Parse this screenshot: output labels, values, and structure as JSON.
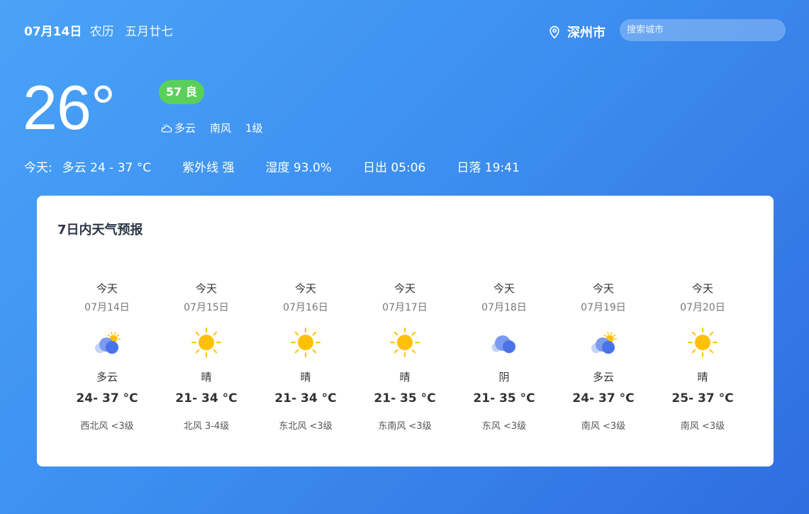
{
  "header": {
    "date": "07月14日",
    "lunar_label": "农历",
    "lunar_day": "五月廿七",
    "city": "深州市",
    "search_placeholder": "搜索城市"
  },
  "current": {
    "temperature": "26°",
    "aqi": "57 良",
    "condition": "多云",
    "wind_dir": "南风",
    "wind_level": "1级",
    "today_label": "今天:",
    "today_summary": "多云 24 - 37 °C",
    "uv": "紫外线 强",
    "humidity": "湿度 93.0%",
    "sunrise": "日出 05:06",
    "sunset": "日落 19:41"
  },
  "forecast": {
    "title": "7日内天气预报",
    "days": [
      {
        "label": "今天",
        "date": "07月14日",
        "icon": "partly-cloudy-icon",
        "desc": "多云",
        "range": "24- 37 °C",
        "wind": "西北风 <3级"
      },
      {
        "label": "今天",
        "date": "07月15日",
        "icon": "sunny-icon",
        "desc": "晴",
        "range": "21- 34 °C",
        "wind": "北风 3-4级"
      },
      {
        "label": "今天",
        "date": "07月16日",
        "icon": "sunny-icon",
        "desc": "晴",
        "range": "21- 34 °C",
        "wind": "东北风 <3级"
      },
      {
        "label": "今天",
        "date": "07月17日",
        "icon": "sunny-icon",
        "desc": "晴",
        "range": "21- 35 °C",
        "wind": "东南风 <3级"
      },
      {
        "label": "今天",
        "date": "07月18日",
        "icon": "overcast-icon",
        "desc": "阴",
        "range": "21- 35 °C",
        "wind": "东风 <3级"
      },
      {
        "label": "今天",
        "date": "07月19日",
        "icon": "partly-cloudy-icon",
        "desc": "多云",
        "range": "24- 37 °C",
        "wind": "南风 <3级"
      },
      {
        "label": "今天",
        "date": "07月20日",
        "icon": "sunny-icon",
        "desc": "晴",
        "range": "25- 37 °C",
        "wind": "南风 <3级"
      }
    ]
  },
  "colors": {
    "aqi_good": "#5ad05a",
    "sun": "#ffc107",
    "cloud": "#4a73e8"
  }
}
